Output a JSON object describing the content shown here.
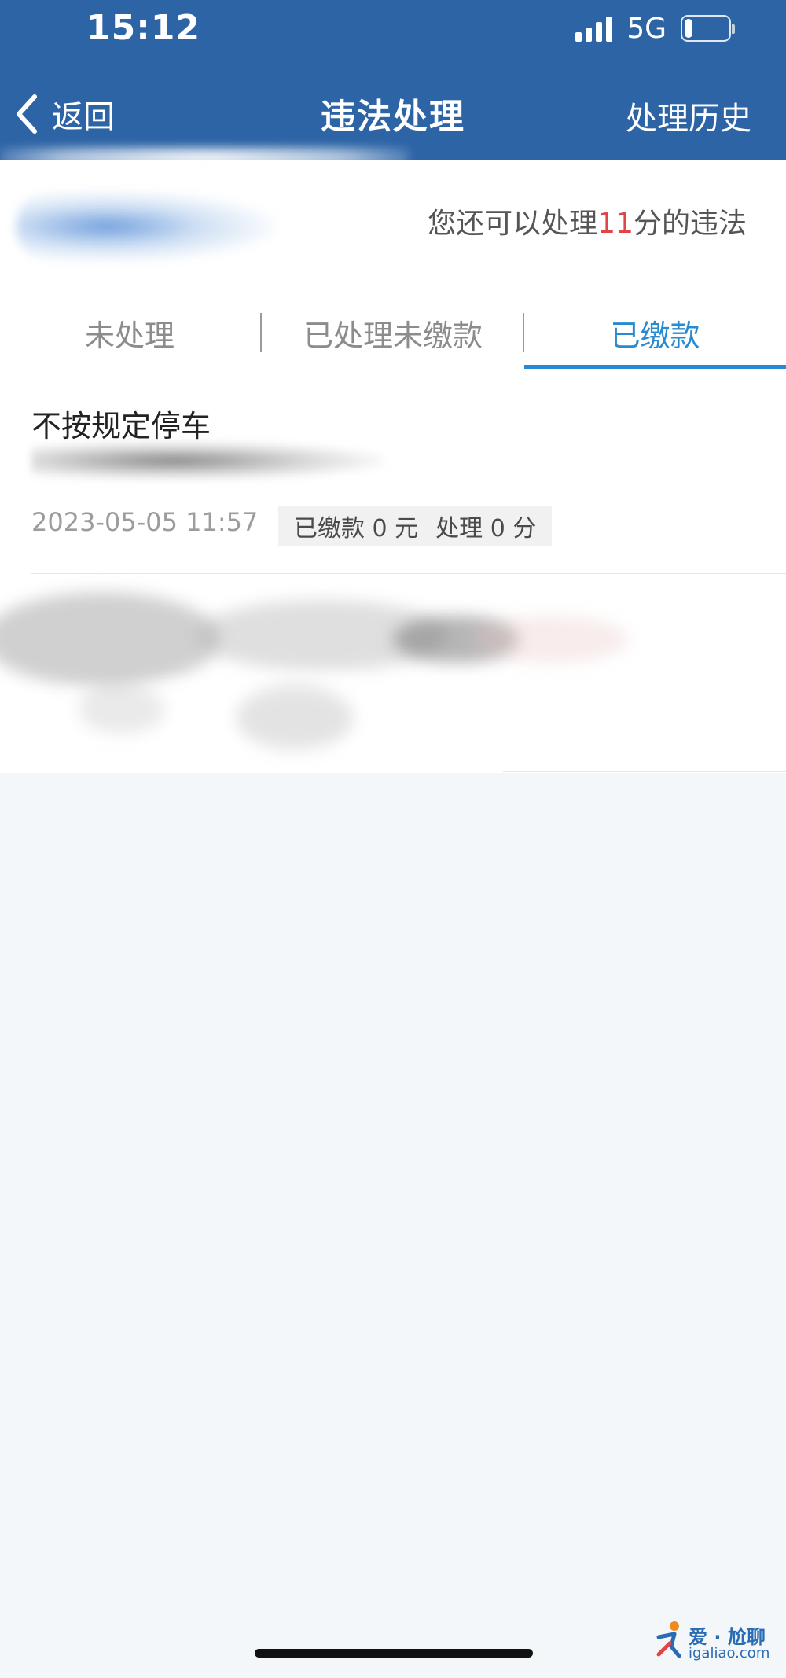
{
  "status_bar": {
    "time": "15:12",
    "network": "5G",
    "battery": "27",
    "battery_level": 0.27
  },
  "nav": {
    "back_label": "返回",
    "title": "违法处理",
    "history_label": "处理历史"
  },
  "summary": {
    "prefix": "您还可以处理",
    "points": "11",
    "suffix": "分的违法"
  },
  "tabs": [
    {
      "label": "未处理",
      "active": false
    },
    {
      "label": "已处理未缴款",
      "active": false
    },
    {
      "label": "已缴款",
      "active": true
    }
  ],
  "records": [
    {
      "title": "不按规定停车",
      "time": "2023-05-05 11:57",
      "paid": "已缴款 0 元",
      "points": "处理 0 分"
    }
  ],
  "watermark": {
    "top": "爱 · 尬聊",
    "bottom": "igaliao.com"
  },
  "colors": {
    "header_bg": "#2d64a6",
    "accent": "#2a8ad0",
    "points_highlight": "#e0454a",
    "page_bg": "#f3f7f9"
  }
}
